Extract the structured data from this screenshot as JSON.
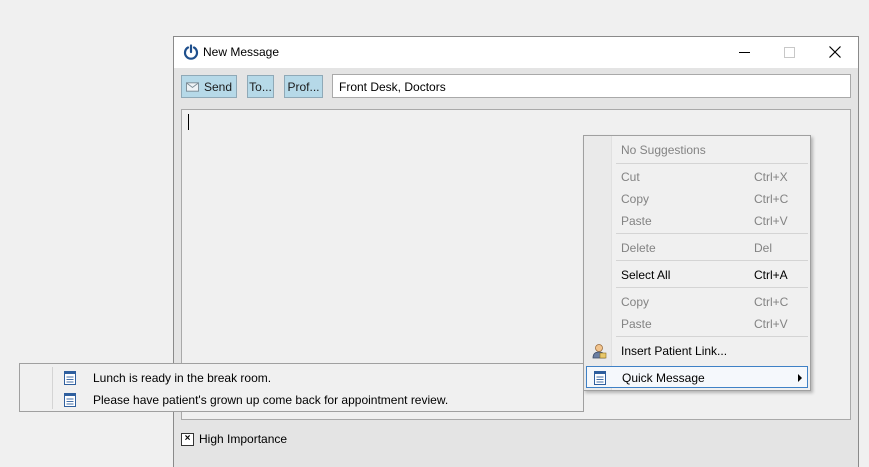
{
  "window": {
    "title": "New Message",
    "icons": {
      "app": "power-icon",
      "minimize": "minimize-icon",
      "maximize": "maximize-icon",
      "close": "close-icon"
    }
  },
  "toolbar": {
    "send_label": "Send",
    "to_label": "To...",
    "profile_label": "Prof...",
    "recipients": "Front Desk, Doctors",
    "button_color": "#b6d9e8"
  },
  "editor": {
    "content": ""
  },
  "footer": {
    "high_importance_label": "High Importance",
    "high_importance_checked": true,
    "check_mark": "×"
  },
  "context_menu": {
    "items": [
      {
        "label": "No Suggestions",
        "shortcut": "",
        "enabled": false
      },
      {
        "label": "Cut",
        "shortcut": "Ctrl+X",
        "enabled": false
      },
      {
        "label": "Copy",
        "shortcut": "Ctrl+C",
        "enabled": false
      },
      {
        "label": "Paste",
        "shortcut": "Ctrl+V",
        "enabled": false
      },
      {
        "label": "Delete",
        "shortcut": "Del",
        "enabled": false
      },
      {
        "label": "Select All",
        "shortcut": "Ctrl+A",
        "enabled": true
      },
      {
        "label": "Copy",
        "shortcut": "Ctrl+C",
        "enabled": false
      },
      {
        "label": "Paste",
        "shortcut": "Ctrl+V",
        "enabled": false
      },
      {
        "label": "Insert Patient Link...",
        "shortcut": "",
        "enabled": true,
        "icon": "patient-icon"
      },
      {
        "label": "Quick Message",
        "shortcut": "",
        "enabled": true,
        "icon": "document-icon",
        "highlighted": true,
        "has_submenu": true
      }
    ],
    "highlight_color": "#3f81c6"
  },
  "submenu": {
    "items": [
      {
        "label": "Lunch is ready in the break room.",
        "icon": "document-icon"
      },
      {
        "label": "Please have patient's grown up come back for appointment review.",
        "icon": "document-icon"
      }
    ]
  }
}
